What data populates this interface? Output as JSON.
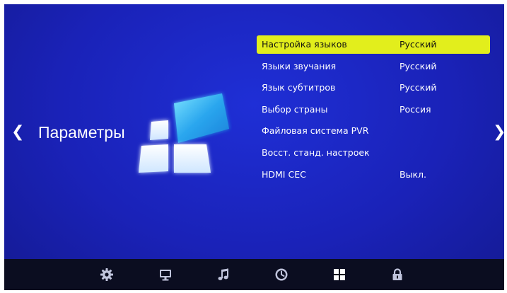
{
  "header": {
    "section_title": "Параметры"
  },
  "menu": {
    "items": [
      {
        "label": "Настройка языков",
        "value": "Русский",
        "selected": true
      },
      {
        "label": "Языки звучания",
        "value": "Русский"
      },
      {
        "label": "Язык субтитров",
        "value": "Русский"
      },
      {
        "label": "Выбор страны",
        "value": "Россия"
      },
      {
        "label": "Файловая система PVR",
        "value": ""
      },
      {
        "label": "Восст. станд. настроек",
        "value": ""
      },
      {
        "label": "HDMI CEC",
        "value": "Выкл."
      }
    ]
  },
  "nav_icons": [
    "gear-icon",
    "monitor-icon",
    "music-note-icon",
    "clock-icon",
    "grid-icon",
    "lock-icon"
  ],
  "colors": {
    "background": "#1a22b8",
    "highlight": "#e2ee1c",
    "bottom_bar": "#0b0d20",
    "icon": "#c0c4dc"
  }
}
